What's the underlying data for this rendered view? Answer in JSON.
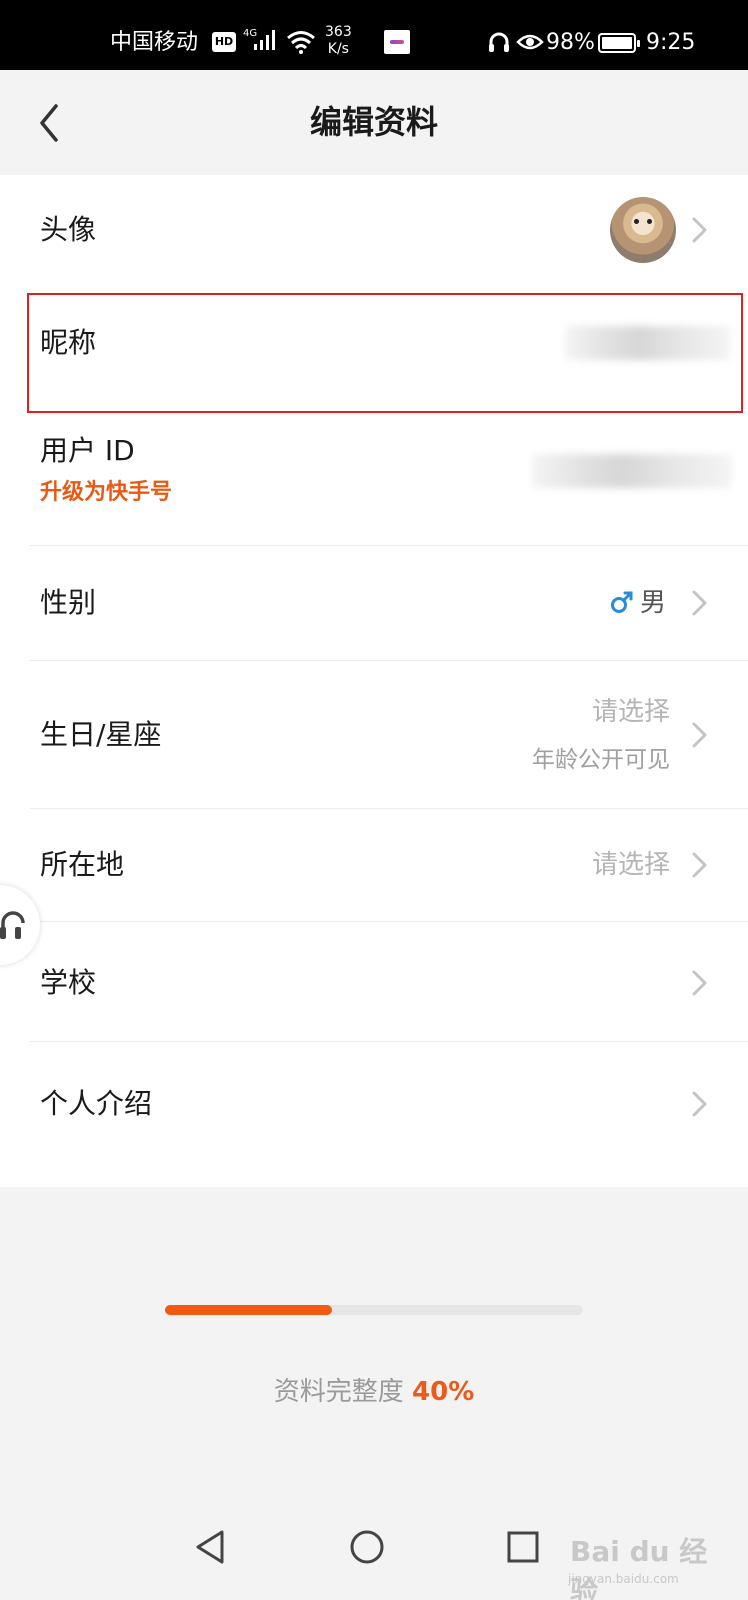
{
  "status_bar": {
    "carrier": "中国移动",
    "hd": "HD",
    "network": "4G",
    "speed_value": "363",
    "speed_unit": "K/s",
    "battery": "98%",
    "time": "9:25"
  },
  "header": {
    "title": "编辑资料",
    "back_icon": "chevron-left-icon"
  },
  "rows": {
    "avatar": {
      "label": "头像"
    },
    "nickname": {
      "label": "昵称",
      "value_redacted": true
    },
    "user_id": {
      "label": "用户 ID",
      "action": "升级为快手号",
      "value_redacted": true
    },
    "gender": {
      "label": "性别",
      "value": "男",
      "icon": "male-icon"
    },
    "birthday": {
      "label": "生日/星座",
      "value": "请选择",
      "sub": "年龄公开可见"
    },
    "location": {
      "label": "所在地",
      "value": "请选择"
    },
    "school": {
      "label": "学校"
    },
    "bio": {
      "label": "个人介绍"
    }
  },
  "completeness": {
    "label": "资料完整度",
    "percent_text": "40%",
    "fraction": 0.4
  },
  "colors": {
    "accent": "#e85a14",
    "highlight_border": "#e02020",
    "male_icon": "#2a8bd6"
  },
  "watermark": {
    "brand": "Bai du 经验",
    "url": "jingyan.baidu.com"
  }
}
